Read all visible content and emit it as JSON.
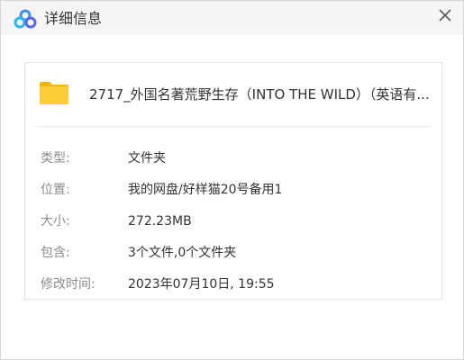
{
  "window": {
    "title": "详细信息",
    "logo_icon": "baidu-netdisk-logo-icon",
    "close_icon": "close-icon"
  },
  "file": {
    "icon": "folder-icon",
    "name": "2717_外国名著荒野生存（INTO THE WILD）（英语有..."
  },
  "details": {
    "type_label": "类型:",
    "type_value": "文件夹",
    "location_label": "位置:",
    "location_value": "我的网盘/好样猫20号备用1",
    "size_label": "大小:",
    "size_value": "272.23MB",
    "contains_label": "包含:",
    "contains_value": "3个文件,0个文件夹",
    "modified_label": "修改时间:",
    "modified_value": "2023年07月10日, 19:55"
  },
  "colors": {
    "titlebar_bg": "#f5f5f5",
    "folder": "#ffc92d",
    "label_text": "#8c8c8c",
    "value_text": "#333333"
  }
}
